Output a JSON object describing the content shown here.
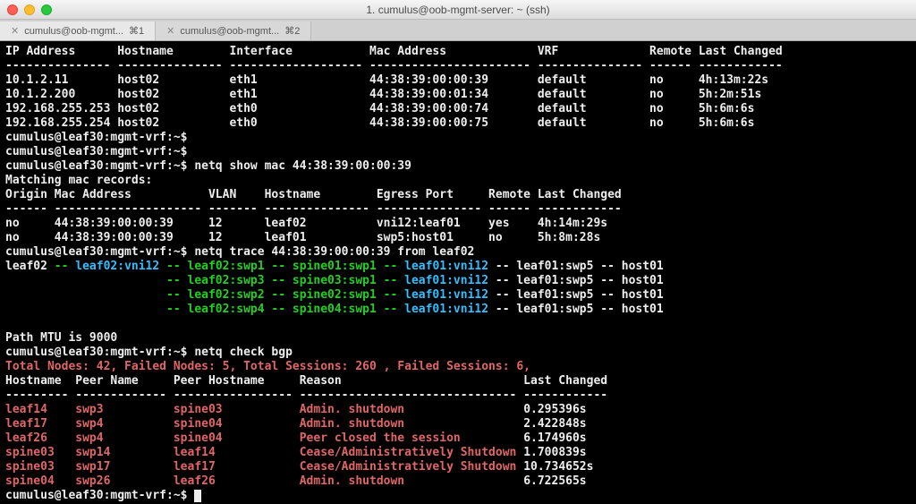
{
  "window": {
    "title": "1. cumulus@oob-mgmt-server: ~ (ssh)",
    "tabs": [
      {
        "label": "cumulus@oob-mgmt...",
        "suffix": "⌘1",
        "active": true
      },
      {
        "label": "cumulus@oob-mgmt...",
        "suffix": "⌘2",
        "active": false
      }
    ]
  },
  "arp_header": {
    "ip": "IP Address",
    "host": "Hostname",
    "ifc": "Interface",
    "mac": "Mac Address",
    "vrf": "VRF",
    "remote": "Remote",
    "lastchg": "Last Changed"
  },
  "arp_rows": [
    {
      "ip": "10.1.2.11",
      "host": "host02",
      "ifc": "eth1",
      "mac": "44:38:39:00:00:39",
      "vrf": "default",
      "remote": "no",
      "lastchg": "4h:13m:22s"
    },
    {
      "ip": "10.1.2.200",
      "host": "host02",
      "ifc": "eth1",
      "mac": "44:38:39:00:01:34",
      "vrf": "default",
      "remote": "no",
      "lastchg": "5h:2m:51s"
    },
    {
      "ip": "192.168.255.253",
      "host": "host02",
      "ifc": "eth0",
      "mac": "44:38:39:00:00:74",
      "vrf": "default",
      "remote": "no",
      "lastchg": "5h:6m:6s"
    },
    {
      "ip": "192.168.255.254",
      "host": "host02",
      "ifc": "eth0",
      "mac": "44:38:39:00:00:75",
      "vrf": "default",
      "remote": "no",
      "lastchg": "5h:6m:6s"
    }
  ],
  "prompt": "cumulus@leaf30:mgmt-vrf:~$",
  "cmds": {
    "empty": " ",
    "showmac": "netq show mac 44:38:39:00:00:39",
    "trace": "netq trace 44:38:39:00:00:39 from leaf02",
    "checkbgp": "netq check bgp"
  },
  "mac_header_label": "Matching mac records:",
  "mac_header": {
    "origin": "Origin",
    "mac": "Mac Address",
    "vlan": "VLAN",
    "host": "Hostname",
    "egress": "Egress Port",
    "remote": "Remote",
    "lastchg": "Last Changed"
  },
  "mac_rows": [
    {
      "origin": "no",
      "mac": "44:38:39:00:00:39",
      "vlan": "12",
      "host": "leaf02",
      "egress": "vni12:leaf01",
      "remote": "yes",
      "lastchg": "4h:14m:29s"
    },
    {
      "origin": "no",
      "mac": "44:38:39:00:00:39",
      "vlan": "12",
      "host": "leaf01",
      "egress": "swp5:host01",
      "remote": "no",
      "lastchg": "5h:8m:28s"
    }
  ],
  "trace": {
    "src": "leaf02",
    "src_vni": "leaf02:vni12",
    "dst_vni": "leaf01:vni12",
    "hop_swp": "leaf01:swp5",
    "dst": "host01",
    "paths": [
      {
        "a": "leaf02:swp1",
        "b": "spine01:swp1"
      },
      {
        "a": "leaf02:swp3",
        "b": "spine03:swp1"
      },
      {
        "a": "leaf02:swp2",
        "b": "spine02:swp1"
      },
      {
        "a": "leaf02:swp4",
        "b": "spine04:swp1"
      }
    ]
  },
  "mtu_line": "Path MTU is 9000",
  "bgp_summary": "Total Nodes: 42, Failed Nodes: 5, Total Sessions: 260 , Failed Sessions: 6,",
  "bgp_header": {
    "host": "Hostname",
    "peer": "Peer Name",
    "peerhost": "Peer Hostname",
    "reason": "Reason",
    "lastchg": "Last Changed"
  },
  "bgp_rows": [
    {
      "host": "leaf14",
      "peer": "swp3",
      "peerhost": "spine03",
      "reason": "Admin. shutdown",
      "lastchg": "0.295396s"
    },
    {
      "host": "leaf17",
      "peer": "swp4",
      "peerhost": "spine04",
      "reason": "Admin. shutdown",
      "lastchg": "2.422848s"
    },
    {
      "host": "leaf26",
      "peer": "swp4",
      "peerhost": "spine04",
      "reason": "Peer closed the session",
      "lastchg": "6.174960s"
    },
    {
      "host": "spine03",
      "peer": "swp14",
      "peerhost": "leaf14",
      "reason": "Cease/Administratively Shutdown",
      "lastchg": "1.700839s"
    },
    {
      "host": "spine03",
      "peer": "swp17",
      "peerhost": "leaf17",
      "reason": "Cease/Administratively Shutdown",
      "lastchg": "10.734652s"
    },
    {
      "host": "spine04",
      "peer": "swp26",
      "peerhost": "leaf26",
      "reason": "Admin. shutdown",
      "lastchg": "6.722565s"
    }
  ]
}
